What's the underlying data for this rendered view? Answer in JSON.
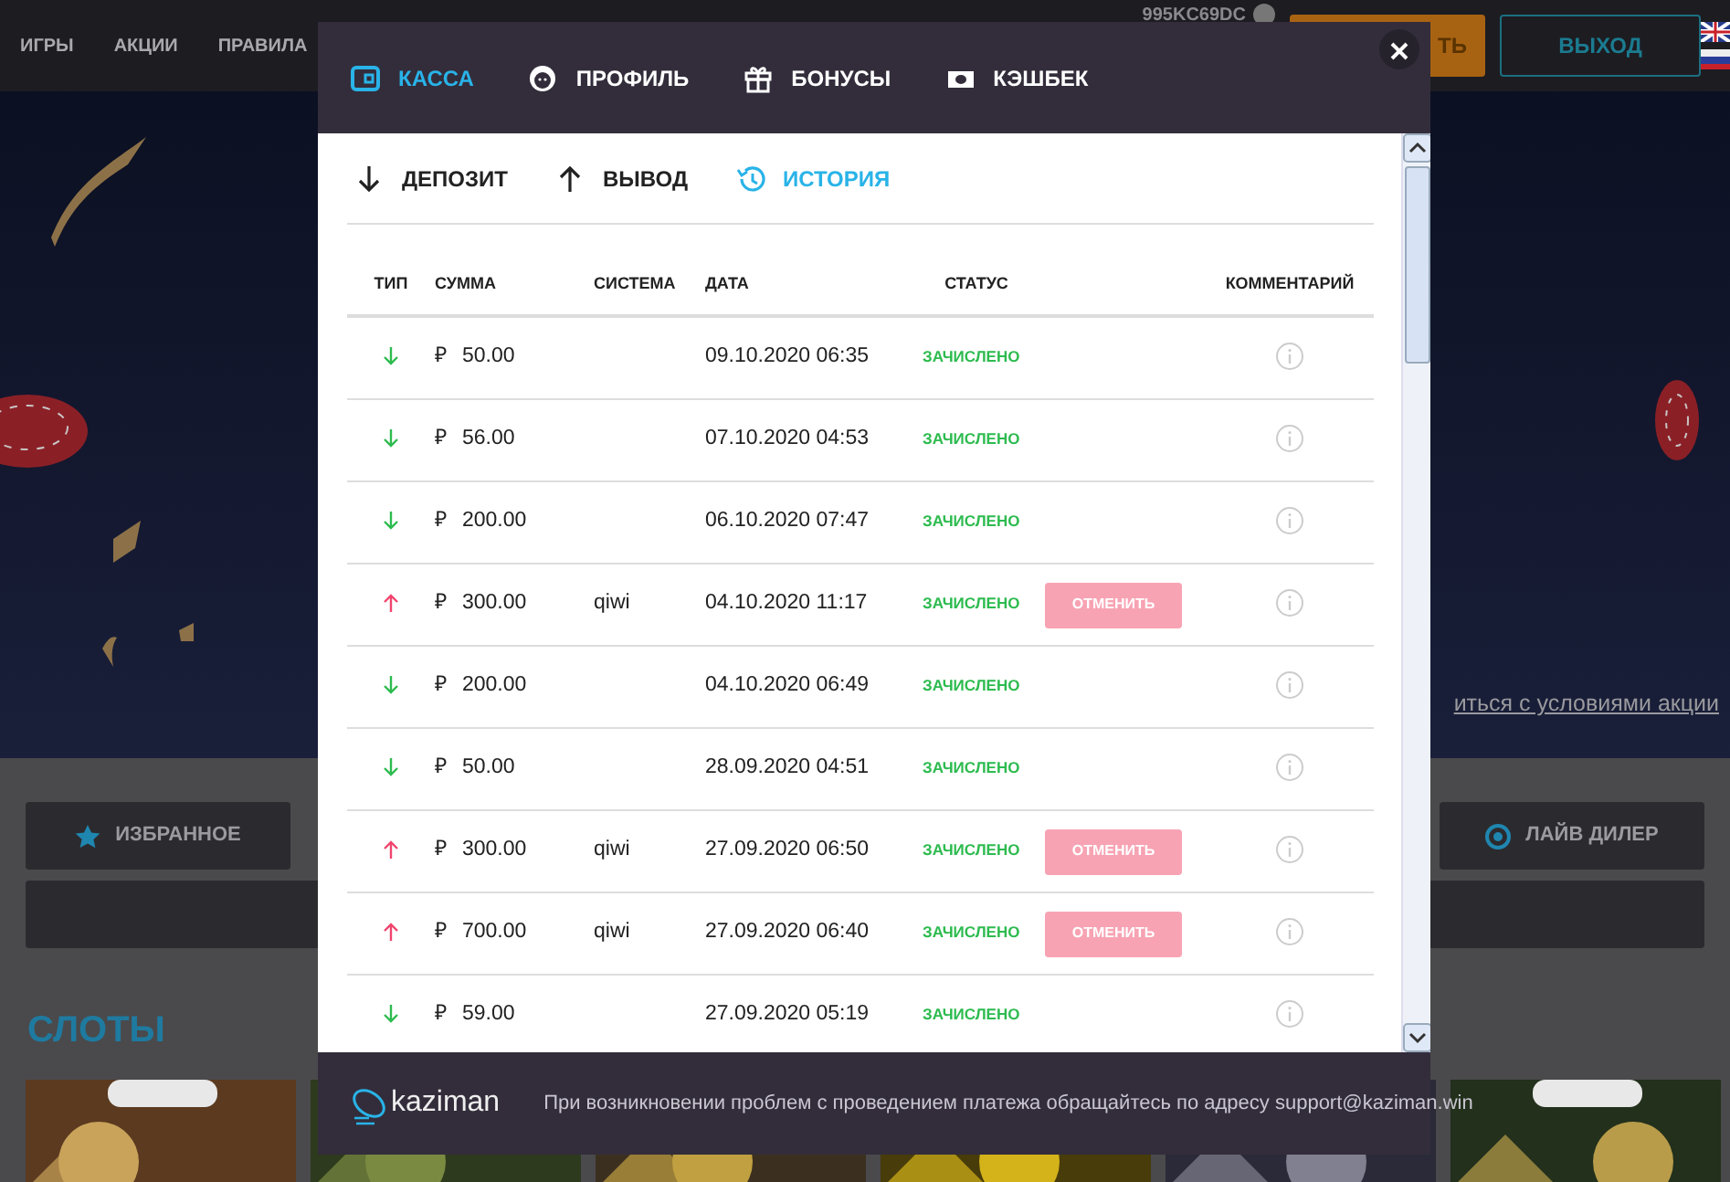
{
  "top_nav": {
    "items": [
      "ИГРЫ",
      "АКЦИИ",
      "ПРАВИЛА"
    ],
    "user_id": "995KC69DC",
    "deposit_button": "ТЬ",
    "logout_button": "ВЫХОД"
  },
  "banner": {
    "kind": "picture",
    "link": "иться с условиями акции"
  },
  "categories": {
    "buttons": [
      {
        "label": "ИЗБРАННОЕ"
      },
      {
        "label": "ЛАЙВ ДИЛЕР"
      }
    ]
  },
  "slots": {
    "title": "СЛОТЫ"
  },
  "modal": {
    "tabs": [
      {
        "label": "КАССА",
        "selected": true
      },
      {
        "label": "ПРОФИЛЬ",
        "selected": false
      },
      {
        "label": "БОНУСЫ",
        "selected": false
      },
      {
        "label": "КЭШБЕК",
        "selected": false
      }
    ],
    "subtabs": [
      {
        "label": "ДЕПОЗИТ",
        "selected": false
      },
      {
        "label": "ВЫВОД",
        "selected": false
      },
      {
        "label": "ИСТОРИЯ",
        "selected": true
      }
    ],
    "table": {
      "columns": [
        "ТИП",
        "СУММА",
        "СИСТЕМА",
        "ДАТА",
        "СТАТУС",
        "КОММЕНТАРИЙ"
      ],
      "rows": [
        {
          "kind": "deposit",
          "currency": "₽",
          "amount": "50.00",
          "system": "",
          "date": "09.10.2020 06:35",
          "status": "ЗАЧИСЛЕНО"
        },
        {
          "kind": "deposit",
          "currency": "₽",
          "amount": "56.00",
          "system": "",
          "date": "07.10.2020 04:53",
          "status": "ЗАЧИСЛЕНО"
        },
        {
          "kind": "deposit",
          "currency": "₽",
          "amount": "200.00",
          "system": "",
          "date": "06.10.2020 07:47",
          "status": "ЗАЧИСЛЕНО"
        },
        {
          "kind": "withdrawal",
          "currency": "₽",
          "amount": "300.00",
          "system": "qiwi",
          "date": "04.10.2020 11:17",
          "status": "ЗАЧИСЛЕНО",
          "cancel": "ОТМЕНИТЬ"
        },
        {
          "kind": "deposit",
          "currency": "₽",
          "amount": "200.00",
          "system": "",
          "date": "04.10.2020 06:49",
          "status": "ЗАЧИСЛЕНО"
        },
        {
          "kind": "deposit",
          "currency": "₽",
          "amount": "50.00",
          "system": "",
          "date": "28.09.2020 04:51",
          "status": "ЗАЧИСЛЕНО"
        },
        {
          "kind": "withdrawal",
          "currency": "₽",
          "amount": "300.00",
          "system": "qiwi",
          "date": "27.09.2020 06:50",
          "status": "ЗАЧИСЛЕНО",
          "cancel": "ОТМЕНИТЬ"
        },
        {
          "kind": "withdrawal",
          "currency": "₽",
          "amount": "700.00",
          "system": "qiwi",
          "date": "27.09.2020 06:40",
          "status": "ЗАЧИСЛЕНО",
          "cancel": "ОТМЕНИТЬ"
        },
        {
          "kind": "deposit",
          "currency": "₽",
          "amount": "59.00",
          "system": "",
          "date": "27.09.2020 05:19",
          "status": "ЗАЧИСЛЕНО"
        }
      ]
    },
    "footer": {
      "logo": "kaziman",
      "text": "При возникновении проблем с проведением платежа обращайтесь по адресу support@kaziman.win"
    }
  }
}
